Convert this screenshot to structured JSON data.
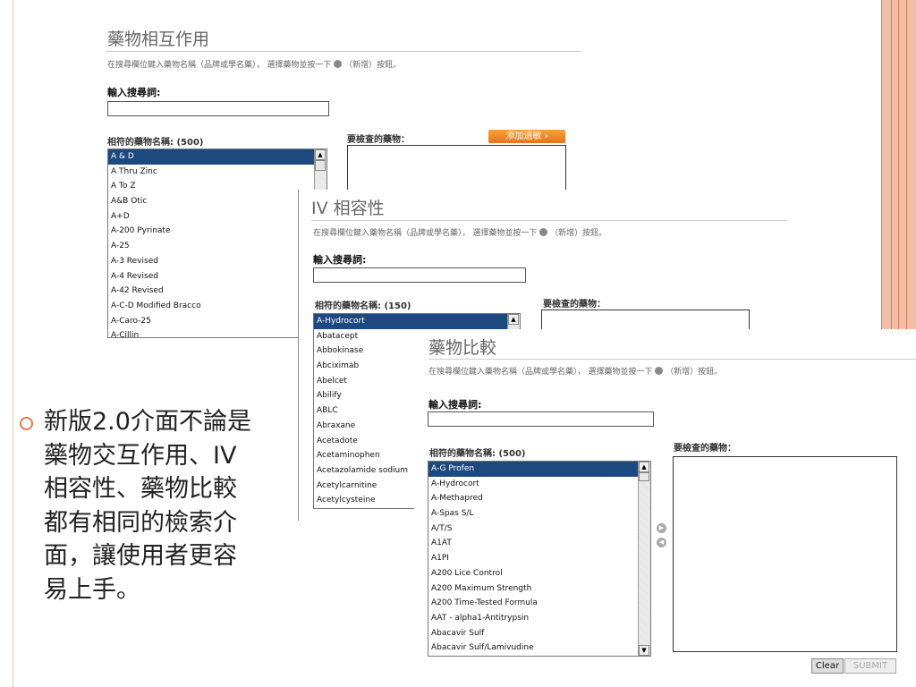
{
  "colors": {
    "accent": "#e07b55",
    "selection": "#1c4a80",
    "add_button": "#f08a2a"
  },
  "panel_interaction": {
    "title": "藥物相互作用",
    "instruction": "在搜尋欄位鍵入藥物名稱（品牌或學名藥）， 選擇藥物並按一下",
    "instruction_tail": "（新增）按鈕。",
    "search_label": "輸入搜尋詞:",
    "search_value": "",
    "matched_label": "相符的藥物名稱: (500)",
    "check_label": "要檢查的藥物：",
    "add_button": "添加過敏",
    "items": [
      "A & D",
      "A Thru Zinc",
      "A To Z",
      "A&B Otic",
      "A+D",
      "A-200 Pyrinate",
      "A-25",
      "A-3 Revised",
      "A-4 Revised",
      "A-42 Revised",
      "A-C-D Modified Bracco",
      "A-Caro-25",
      "A-Cillin"
    ],
    "selected_index": 0
  },
  "panel_iv": {
    "title": "IV 相容性",
    "instruction": "在搜尋欄位鍵入藥物名稱（品牌或學名藥）， 選擇藥物並按一下",
    "instruction_tail": "（新增）按鈕。",
    "search_label": "輸入搜尋詞:",
    "search_value": "",
    "matched_label": "相符的藥物名稱: (150)",
    "check_label": "要檢查的藥物：",
    "items": [
      "A-Hydrocort",
      "Abatacept",
      "Abbokinase",
      "Abciximab",
      "Abelcet",
      "Abilify",
      "ABLC",
      "Abraxane",
      "Acetadote",
      "Acetaminophen",
      "Acetazolamide sodium",
      "Acetylcarnitine",
      "Acetylcysteine"
    ],
    "selected_index": 0
  },
  "panel_compare": {
    "title": "藥物比較",
    "instruction": "在搜尋欄位鍵入藥物名稱（品牌或學名藥）， 選擇藥物並按一下",
    "instruction_tail": "（新增）按鈕。",
    "search_label": "輸入搜尋詞:",
    "search_value": "",
    "matched_label": "相符的藥物名稱: (500)",
    "check_label": "要檢查的藥物：",
    "items": [
      "A-G Profen",
      "A-Hydrocort",
      "A-Methapred",
      "A-Spas S/L",
      "A/T/S",
      "A1AT",
      "A1PI",
      "A200 Lice Control",
      "A200 Maximum Strength",
      "A200 Time-Tested Formula",
      "AAT - alpha1-Antitrypsin",
      "Abacavir Sulf",
      "Abacavir Sulf/Lamivudine"
    ],
    "selected_index": 0,
    "clear_button": "Clear",
    "submit_button": "SUBMIT"
  },
  "bullet": {
    "lines": [
      "新版2.0介面不論是",
      "藥物交互作用、IV",
      "相容性、藥物比較",
      "都有相同的檢索介",
      "面，讓使用者更容",
      "易上手。"
    ]
  }
}
